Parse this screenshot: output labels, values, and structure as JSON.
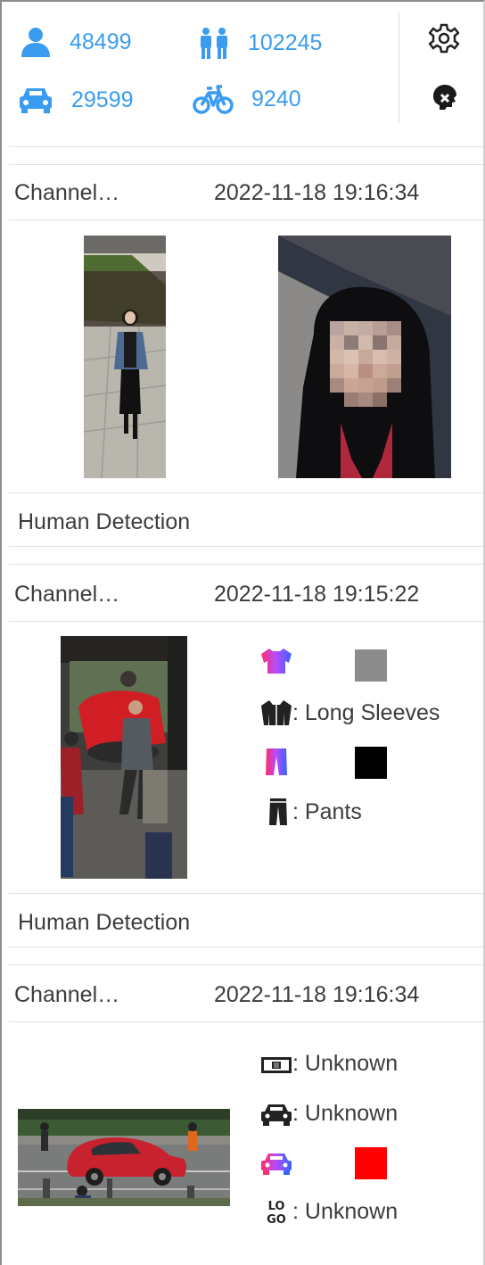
{
  "stats": {
    "person_count": "48499",
    "non_motor_people_count": "102245",
    "vehicle_count": "29599",
    "bicycle_count": "9240"
  },
  "colors": {
    "accent": "#3a9cf0",
    "swatch_top": "#8c8c8c",
    "swatch_bottom": "#000000",
    "swatch_vehicle": "#ff0000"
  },
  "icons": [
    "person-icon",
    "people-icon",
    "car-icon",
    "bicycle-icon",
    "settings-icon",
    "clear-icon",
    "top-color-icon",
    "sleeve-icon",
    "bottom-color-icon",
    "pants-icon",
    "plate-icon",
    "vehicle-type-icon",
    "vehicle-color-icon",
    "logo-icon"
  ],
  "events": [
    {
      "channel": "Channel…",
      "time": "2022-11-18 19:16:34",
      "type": "Human Detection"
    },
    {
      "channel": "Channel…",
      "time": "2022-11-18 19:15:22",
      "attributes": {
        "sleeves": ": Long Sleeves",
        "pants": ": Pants"
      },
      "type": "Human Detection"
    },
    {
      "channel": "Channel…",
      "time": "2022-11-18 19:16:34",
      "attributes": {
        "plate": ": Unknown",
        "vehicle_type": ": Unknown",
        "logo": ": Unknown"
      }
    }
  ]
}
